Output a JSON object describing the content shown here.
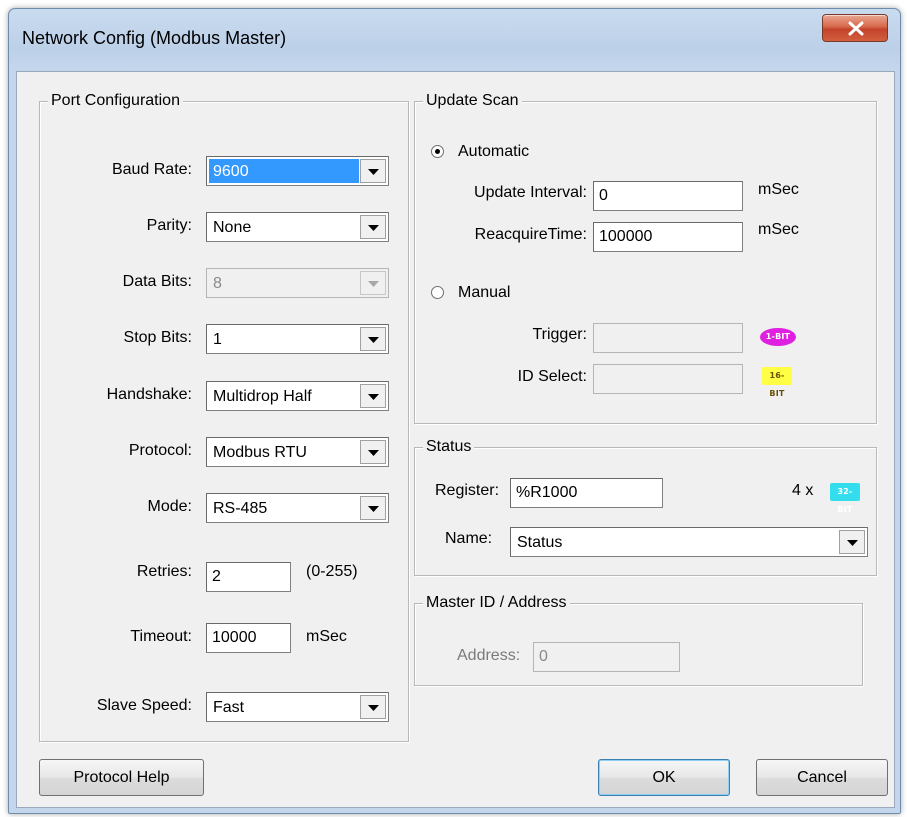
{
  "window": {
    "title": "Network Config (Modbus Master)",
    "close_icon": "close-x-icon"
  },
  "port_config": {
    "title": "Port Configuration",
    "baud_rate": {
      "label": "Baud Rate:",
      "value": "9600"
    },
    "parity": {
      "label": "Parity:",
      "value": "None"
    },
    "data_bits": {
      "label": "Data Bits:",
      "value": "8"
    },
    "stop_bits": {
      "label": "Stop Bits:",
      "value": "1"
    },
    "handshake": {
      "label": "Handshake:",
      "value": "Multidrop Half"
    },
    "protocol": {
      "label": "Protocol:",
      "value": "Modbus RTU"
    },
    "mode": {
      "label": "Mode:",
      "value": "RS-485"
    },
    "retries": {
      "label": "Retries:",
      "value": "2",
      "hint": "(0-255)"
    },
    "timeout": {
      "label": "Timeout:",
      "value": "10000",
      "unit": "mSec"
    },
    "slave_speed": {
      "label": "Slave Speed:",
      "value": "Fast"
    }
  },
  "update_scan": {
    "title": "Update Scan",
    "automatic_label": "Automatic",
    "update_interval": {
      "label": "Update Interval:",
      "value": "0",
      "unit": "mSec"
    },
    "reacquire_time": {
      "label": "ReacquireTime:",
      "value": "100000",
      "unit": "mSec"
    },
    "manual_label": "Manual",
    "trigger": {
      "label": "Trigger:",
      "value": "",
      "badge": "1-BIT"
    },
    "id_select": {
      "label": "ID Select:",
      "value": "",
      "badge": "16-BIT"
    }
  },
  "status": {
    "title": "Status",
    "register": {
      "label": "Register:",
      "value": "%R1000",
      "count": "4 x",
      "badge": "32-BIT"
    },
    "name": {
      "label": "Name:",
      "value": "Status"
    }
  },
  "master": {
    "title": "Master ID / Address",
    "address": {
      "label": "Address:",
      "value": "0"
    }
  },
  "buttons": {
    "protocol_help": "Protocol Help",
    "ok": "OK",
    "cancel": "Cancel"
  },
  "colors": {
    "selection": "#3399ff",
    "badge_1bit": "#e020e0",
    "badge_16bit": "#ffff44",
    "badge_32bit": "#33ddee",
    "close_button": "#c3432a"
  }
}
